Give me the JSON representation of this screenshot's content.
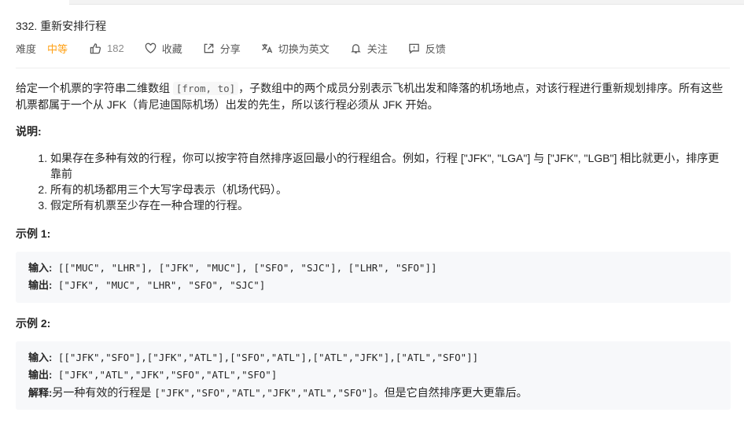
{
  "problem": {
    "title": "332. 重新安排行程",
    "difficulty_label": "难度",
    "difficulty": "中等",
    "likes": "182",
    "actions": {
      "collect": "收藏",
      "share": "分享",
      "translate": "切换为英文",
      "follow": "关注",
      "feedback": "反馈"
    }
  },
  "description": {
    "p1_a": "给定一个机票的字符串二维数组 ",
    "p1_code": "[from, to]",
    "p1_b": "，子数组中的两个成员分别表示飞机出发和降落的机场地点，对该行程进行重新规划排序。所有这些机票都属于一个从 JFK（肯尼迪国际机场）出发的先生，所以该行程必须从 JFK 开始。",
    "notes_title": "说明:",
    "notes": [
      "如果存在多种有效的行程，你可以按字符自然排序返回最小的行程组合。例如，行程 [\"JFK\", \"LGA\"] 与 [\"JFK\", \"LGB\"] 相比就更小，排序更靠前",
      "所有的机场都用三个大写字母表示（机场代码）。",
      "假定所有机票至少存在一种合理的行程。"
    ]
  },
  "examples": [
    {
      "title": "示例 1:",
      "input_label": "输入:",
      "input": " [[\"MUC\", \"LHR\"], [\"JFK\", \"MUC\"], [\"SFO\", \"SJC\"], [\"LHR\", \"SFO\"]]",
      "output_label": "输出:",
      "output": " [\"JFK\", \"MUC\", \"LHR\", \"SFO\", \"SJC\"]"
    },
    {
      "title": "示例 2:",
      "input_label": "输入:",
      "input": " [[\"JFK\",\"SFO\"],[\"JFK\",\"ATL\"],[\"SFO\",\"ATL\"],[\"ATL\",\"JFK\"],[\"ATL\",\"SFO\"]]",
      "output_label": "输出:",
      "output": " [\"JFK\",\"ATL\",\"JFK\",\"SFO\",\"ATL\",\"SFO\"]",
      "explain_label": "解释:",
      "explain_a": "另一种有效的行程是 ",
      "explain_code": " [\"JFK\",\"SFO\",\"ATL\",\"JFK\",\"ATL\",\"SFO\"]",
      "explain_b": "。但是它自然排序更大更靠后。"
    }
  ]
}
